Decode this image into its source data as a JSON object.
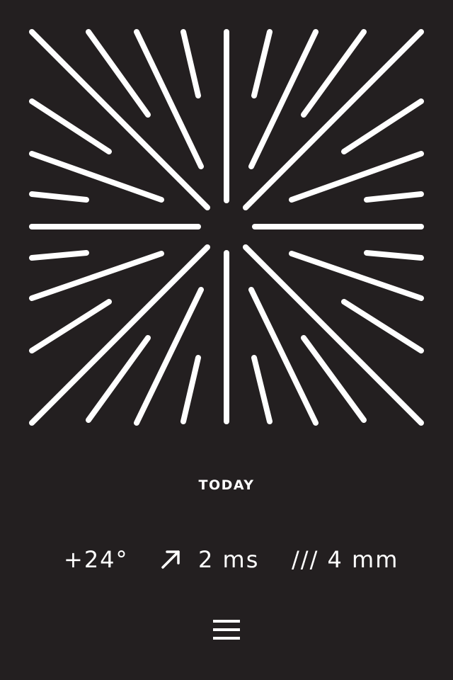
{
  "graphic": {
    "icon": "sunburst-icon",
    "color": "#ffffff",
    "background": "#231f20"
  },
  "forecast": {
    "day": "TODAY",
    "temperature": "+24°",
    "wind_icon": "arrow-up-right-icon",
    "wind": "2 ms",
    "precipitation": "/// 4 mm"
  },
  "menu": {
    "icon": "hamburger-menu-icon"
  }
}
